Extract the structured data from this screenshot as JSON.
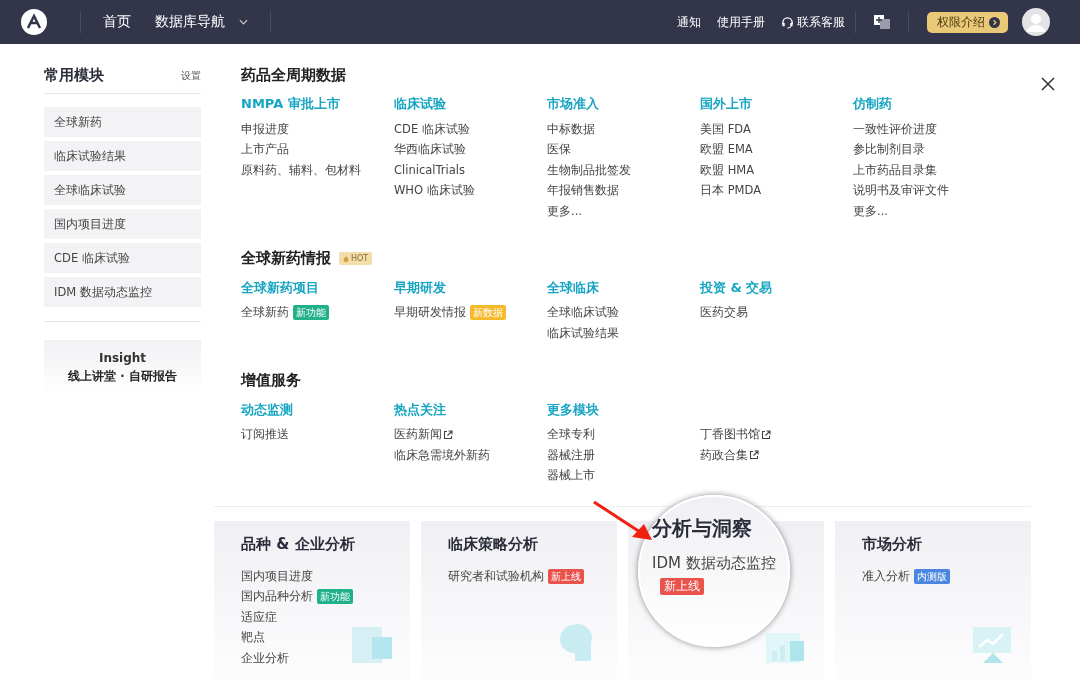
{
  "topbar": {
    "nav": [
      {
        "label": "首页",
        "dropdown": false
      },
      {
        "label": "数据库导航",
        "dropdown": true
      }
    ],
    "links": [
      {
        "label": "通知",
        "kind": "plain"
      },
      {
        "label": "使用手册",
        "kind": "plain"
      },
      {
        "label": "联系客服",
        "kind": "support"
      }
    ],
    "upgrade_button": "权限介绍"
  },
  "sidebar": {
    "title": "常用模块",
    "settings": "设置",
    "items": [
      "全球新药",
      "临床试验结果",
      "全球临床试验",
      "国内项目进度",
      "CDE 临床试验",
      "IDM 数据动态监控"
    ],
    "promo": {
      "title": "Insight",
      "subtitle": "线上讲堂 · 自研报告"
    }
  },
  "sections": [
    {
      "title": "药品全周期数据",
      "hot": false,
      "columns": [
        {
          "title": "NMPA 审批上市",
          "items": [
            {
              "label": "申报进度"
            },
            {
              "label": "上市产品"
            },
            {
              "label": "原料药、辅料、包材料"
            }
          ]
        },
        {
          "title": "临床试验",
          "items": [
            {
              "label": "CDE 临床试验"
            },
            {
              "label": "华西临床试验"
            },
            {
              "label": "ClinicalTrials"
            },
            {
              "label": "WHO 临床试验"
            }
          ]
        },
        {
          "title": "市场准入",
          "items": [
            {
              "label": "中标数据"
            },
            {
              "label": "医保"
            },
            {
              "label": "生物制品批签发"
            },
            {
              "label": "年报销售数据"
            },
            {
              "label": "更多..."
            }
          ]
        },
        {
          "title": "国外上市",
          "items": [
            {
              "label": "美国 FDA"
            },
            {
              "label": "欧盟 EMA"
            },
            {
              "label": "欧盟 HMA"
            },
            {
              "label": "日本 PMDA"
            }
          ]
        },
        {
          "title": "仿制药",
          "items": [
            {
              "label": "一致性评价进度"
            },
            {
              "label": "参比制剂目录"
            },
            {
              "label": "上市药品目录集"
            },
            {
              "label": "说明书及审评文件"
            },
            {
              "label": "更多..."
            }
          ]
        }
      ]
    },
    {
      "title": "全球新药情报",
      "hot": true,
      "hot_label": "HOT",
      "columns": [
        {
          "title": "全球新药项目",
          "items": [
            {
              "label": "全球新药",
              "badge": {
                "text": "新功能",
                "color": "#20b08a"
              }
            }
          ]
        },
        {
          "title": "早期研发",
          "items": [
            {
              "label": "早期研发情报",
              "badge": {
                "text": "新数据",
                "color": "#f6b92c"
              }
            }
          ]
        },
        {
          "title": "全球临床",
          "items": [
            {
              "label": "全球临床试验"
            },
            {
              "label": "临床试验结果"
            }
          ]
        },
        {
          "title": "投资 & 交易",
          "items": [
            {
              "label": "医药交易"
            }
          ]
        }
      ]
    },
    {
      "title": "增值服务",
      "hot": false,
      "columns": [
        {
          "title": "动态监测",
          "items": [
            {
              "label": "订阅推送"
            }
          ]
        },
        {
          "title": "热点关注",
          "items": [
            {
              "label": "医药新闻",
              "external": true
            },
            {
              "label": "临床急需境外新药"
            }
          ]
        },
        {
          "title": "更多模块",
          "items": [
            {
              "label": "全球专利"
            },
            {
              "label": "器械注册"
            },
            {
              "label": "器械上市"
            }
          ]
        },
        {
          "items": [
            {
              "label": "丁香图书馆",
              "external": true
            },
            {
              "label": "药政合集",
              "external": true
            }
          ]
        }
      ]
    }
  ],
  "cards": [
    {
      "kind": "normal",
      "title": "品种 & 企业分析",
      "items": [
        {
          "label": "国内项目进度"
        },
        {
          "label": "国内品种分析",
          "badge": {
            "text": "新功能",
            "color": "#20b08a"
          }
        },
        {
          "label": "适应症"
        },
        {
          "label": "靶点"
        },
        {
          "label": "企业分析"
        }
      ]
    },
    {
      "kind": "normal",
      "title": "临床策略分析",
      "items": [
        {
          "label": "研究者和试验机构",
          "badge": {
            "text": "新上线",
            "color": "#e9534c"
          }
        }
      ]
    },
    {
      "kind": "magnified",
      "title": "分析与洞察",
      "items": [
        {
          "label": "IDM 数据动态监控",
          "badge": {
            "text": "新上线",
            "color": "#e9534c"
          }
        }
      ]
    },
    {
      "kind": "normal",
      "title": "市场分析",
      "items": [
        {
          "label": "准入分析",
          "badge": {
            "text": "内测版",
            "color": "#4a86e0"
          }
        }
      ]
    }
  ]
}
